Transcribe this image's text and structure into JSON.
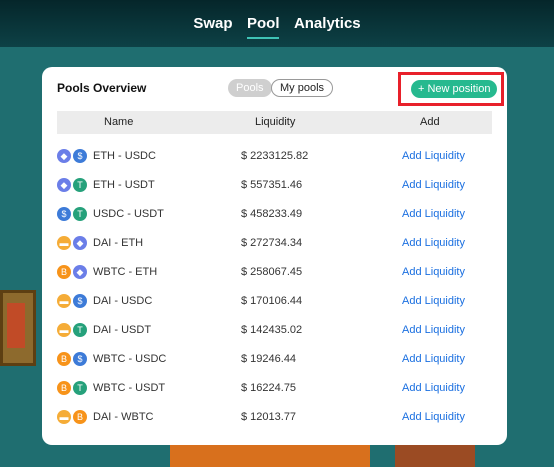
{
  "nav": {
    "items": [
      "Swap",
      "Pool",
      "Analytics"
    ],
    "active": "Pool"
  },
  "card": {
    "title": "Pools Overview",
    "tabs": [
      "Pools",
      "My pools"
    ],
    "new_position_label": "+ New position",
    "columns": [
      "Name",
      "Liquidity",
      "Add"
    ]
  },
  "token_colors": {
    "ETH": "#6b7ee8",
    "USDC": "#3d7bd8",
    "USDT": "#26a17b",
    "DAI": "#f5ac37",
    "WBTC": "#f7931a"
  },
  "rows": [
    {
      "icons": [
        "ETH",
        "USDC"
      ],
      "pair": "ETH - USDC",
      "liquidity": "$ 2233125.82",
      "action": "Add Liquidity"
    },
    {
      "icons": [
        "ETH",
        "USDT"
      ],
      "pair": "ETH - USDT",
      "liquidity": "$ 557351.46",
      "action": "Add Liquidity"
    },
    {
      "icons": [
        "USDC",
        "USDT"
      ],
      "pair": "USDC - USDT",
      "liquidity": "$ 458233.49",
      "action": "Add Liquidity"
    },
    {
      "icons": [
        "DAI",
        "ETH"
      ],
      "pair": "DAI - ETH",
      "liquidity": "$ 272734.34",
      "action": "Add Liquidity"
    },
    {
      "icons": [
        "WBTC",
        "ETH"
      ],
      "pair": "WBTC - ETH",
      "liquidity": "$ 258067.45",
      "action": "Add Liquidity"
    },
    {
      "icons": [
        "DAI",
        "USDC"
      ],
      "pair": "DAI - USDC",
      "liquidity": "$ 170106.44",
      "action": "Add Liquidity"
    },
    {
      "icons": [
        "DAI",
        "USDT"
      ],
      "pair": "DAI - USDT",
      "liquidity": "$ 142435.02",
      "action": "Add Liquidity"
    },
    {
      "icons": [
        "WBTC",
        "USDC"
      ],
      "pair": "WBTC - USDC",
      "liquidity": "$ 19246.44",
      "action": "Add Liquidity"
    },
    {
      "icons": [
        "WBTC",
        "USDT"
      ],
      "pair": "WBTC - USDT",
      "liquidity": "$ 16224.75",
      "action": "Add Liquidity"
    },
    {
      "icons": [
        "DAI",
        "WBTC"
      ],
      "pair": "DAI - WBTC",
      "liquidity": "$ 12013.77",
      "action": "Add Liquidity"
    }
  ]
}
